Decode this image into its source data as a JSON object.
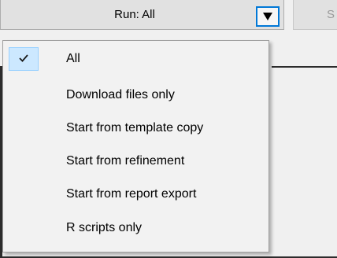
{
  "toolbar": {
    "run_label": "Run: All",
    "side_button_label": "S"
  },
  "menu": {
    "items": [
      {
        "label": "All",
        "checked": true
      },
      {
        "label": "Download files only",
        "checked": false
      },
      {
        "label": "Start from template copy",
        "checked": false
      },
      {
        "label": "Start from refinement",
        "checked": false
      },
      {
        "label": "Start from report export",
        "checked": false
      },
      {
        "label": "R scripts only",
        "checked": false
      }
    ]
  },
  "icons": {
    "dropdown": "triangle-down-icon",
    "check": "checkmark-icon"
  },
  "colors": {
    "accent_border": "#0078d7",
    "selection_fill": "#cce8ff",
    "selection_border": "#99d1ff"
  }
}
